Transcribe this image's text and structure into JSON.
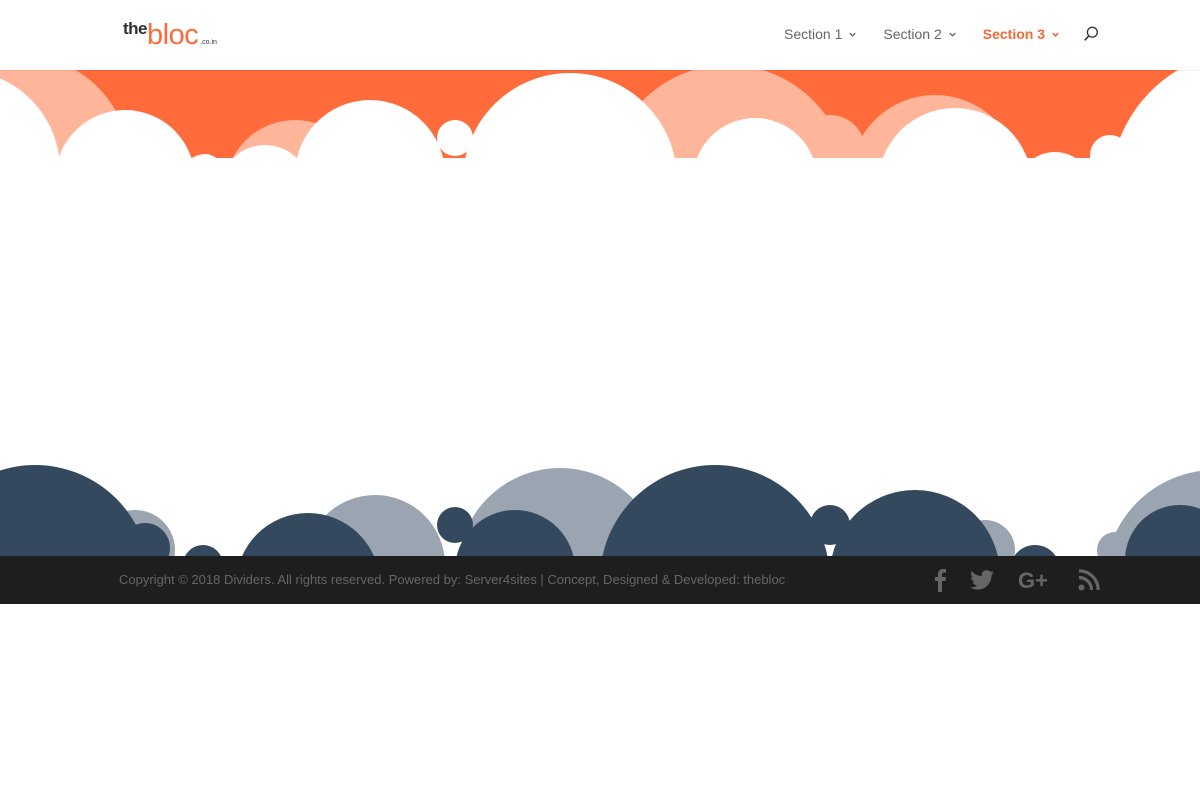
{
  "brand": {
    "logo_the": "the",
    "logo_bloc": "bloc",
    "logo_tld": ".co.in"
  },
  "nav": {
    "items": [
      {
        "label": "Section 1",
        "active": false
      },
      {
        "label": "Section 2",
        "active": false
      },
      {
        "label": "Section 3",
        "active": true
      }
    ],
    "search_icon": "search-icon"
  },
  "colors": {
    "accent": "#ff6b3a",
    "top_cloud_light": "#ffb59a",
    "bottom_cloud_dark": "#34495e",
    "bottom_cloud_light": "#9aa5b1",
    "footer_bg": "#1e1e1e"
  },
  "footer": {
    "copyright": "Copyright © 2018 Dividers. All rights reserved. Powered by: Server4sites | Concept, Designed & Developed: thebloc",
    "social": [
      "facebook-icon",
      "twitter-icon",
      "google-plus-icon",
      "rss-icon"
    ]
  }
}
